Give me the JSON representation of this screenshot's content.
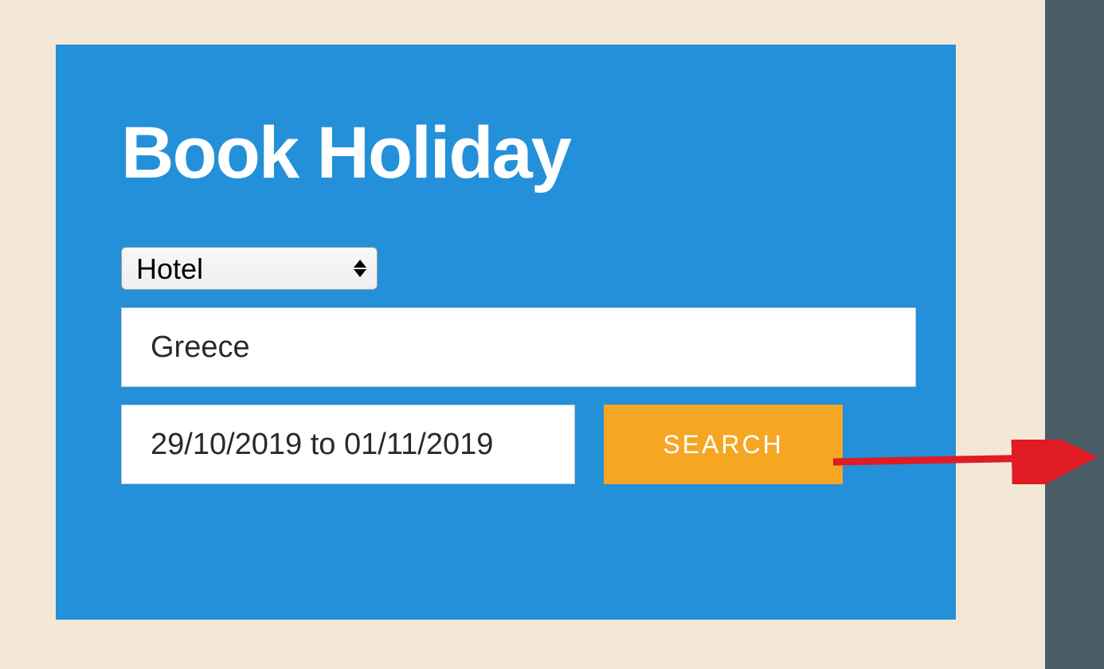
{
  "form": {
    "title": "Book Holiday",
    "type_select": {
      "selected": "Hotel"
    },
    "destination": {
      "value": "Greece"
    },
    "dates": {
      "value": "29/10/2019 to 01/11/2019"
    },
    "search_button_label": "SEARCH"
  },
  "colors": {
    "card_bg": "#2390d9",
    "page_bg": "#f2e8d5",
    "sidebar_bg": "#4a5c66",
    "button_bg": "#f5a623",
    "annotation": "#e01b24"
  }
}
